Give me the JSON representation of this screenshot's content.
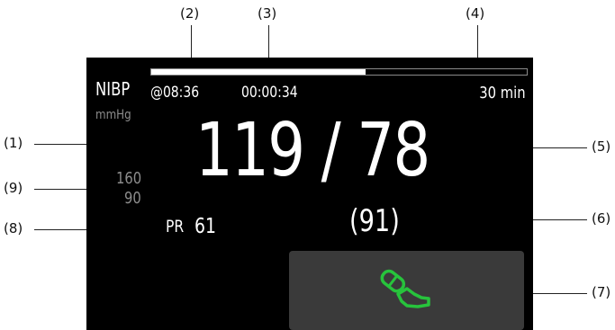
{
  "callouts": {
    "c1": "(1)",
    "c2": "(2)",
    "c3": "(3)",
    "c4": "(4)",
    "c5": "(5)",
    "c6": "(6)",
    "c7": "(7)",
    "c8": "(8)",
    "c9": "(9)"
  },
  "nibp": {
    "label": "NIBP",
    "unit": "mmHg",
    "start_time": "@08:36",
    "elapsed": "00:00:34",
    "interval": "30 min",
    "progress_fraction": 0.57,
    "reading": "119 / 78",
    "mean": "(91)",
    "alarm_limits": {
      "high": "160",
      "low": "90"
    },
    "pulse_rate": {
      "label": "PR",
      "value": "61"
    },
    "start_button_icon": "cuff-icon"
  },
  "colors": {
    "screen_bg": "#000000",
    "value_text": "#ffffff",
    "secondary_text": "#8c8c8c",
    "button_bg": "#3a3a3a",
    "icon_green": "#27c33c"
  }
}
